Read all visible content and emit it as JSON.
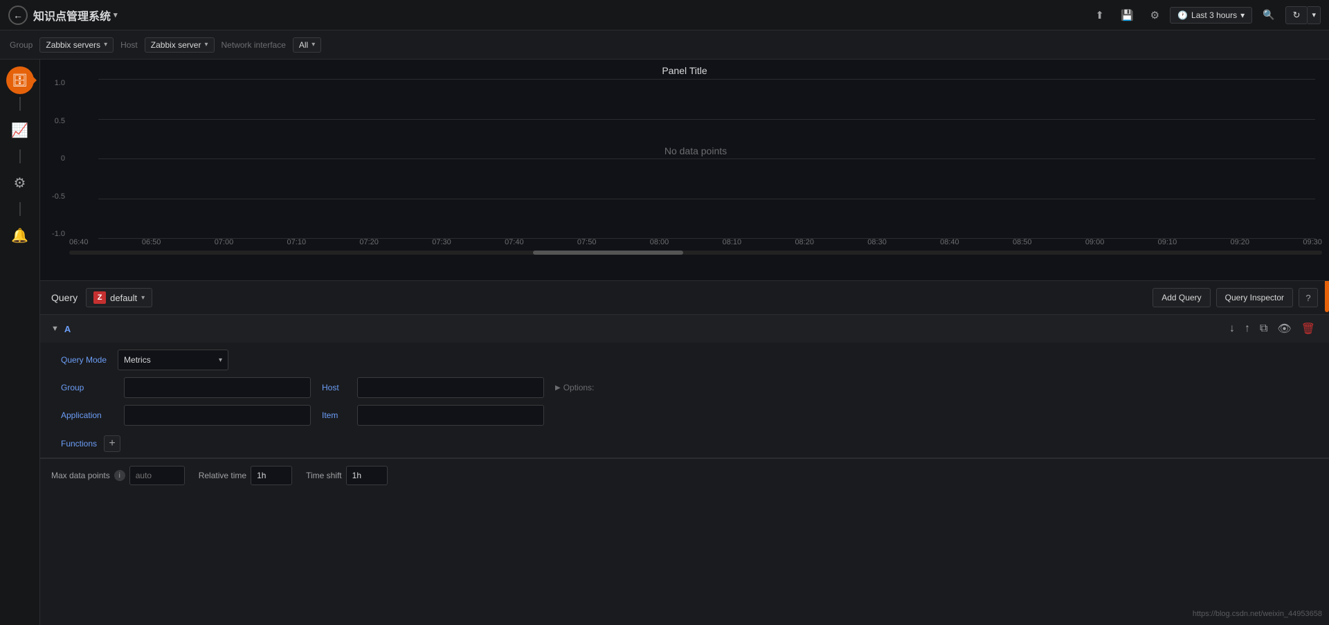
{
  "topbar": {
    "back_label": "←",
    "title": "知识点管理系统",
    "title_caret": "▾",
    "share_icon": "⬆",
    "save_icon": "💾",
    "settings_icon": "⚙",
    "time_range": "Last 3 hours",
    "search_icon": "🔍",
    "refresh_icon": "↻",
    "caret_icon": "▾"
  },
  "filterbar": {
    "group_label": "Group",
    "group_value": "Zabbix servers",
    "host_label": "Host",
    "host_value": "Zabbix server",
    "network_interface_label": "Network interface",
    "network_interface_value": "All"
  },
  "sidebar": {
    "database_icon": "🗄",
    "chart_icon": "📈",
    "gear_icon": "⚙",
    "bell_icon": "🔔"
  },
  "chart": {
    "panel_title": "Panel Title",
    "no_data": "No data points",
    "y_labels": [
      "1.0",
      "0.5",
      "0",
      "-0.5",
      "-1.0"
    ],
    "x_labels": [
      "06:40",
      "06:50",
      "07:00",
      "07:10",
      "07:20",
      "07:30",
      "07:40",
      "07:50",
      "08:00",
      "08:10",
      "08:20",
      "08:30",
      "08:40",
      "08:50",
      "09:00",
      "09:10",
      "09:20",
      "09:30",
      "09:30"
    ]
  },
  "query": {
    "label": "Query",
    "datasource": "default",
    "add_query_label": "Add Query",
    "inspector_label": "Query Inspector",
    "help_label": "?",
    "row_id": "A",
    "collapse_icon": "▼",
    "query_mode_label": "Query Mode",
    "query_mode_value": "Metrics",
    "query_mode_caret": "▾",
    "group_label": "Group",
    "host_label": "Host",
    "application_label": "Application",
    "item_label": "Item",
    "options_label": "▶ Options:",
    "functions_label": "Functions",
    "add_fn_label": "+",
    "move_down_icon": "↓",
    "move_up_icon": "↑",
    "duplicate_icon": "⧉",
    "eye_icon": "👁",
    "delete_icon": "🗑"
  },
  "bottom": {
    "max_data_points_label": "Max data points",
    "max_data_points_placeholder": "auto",
    "relative_time_label": "Relative time",
    "relative_time_value": "1h",
    "time_shift_label": "Time shift",
    "time_shift_value": "1h"
  },
  "watermark": {
    "url": "https://blog.csdn.net/weixin_44953658"
  }
}
